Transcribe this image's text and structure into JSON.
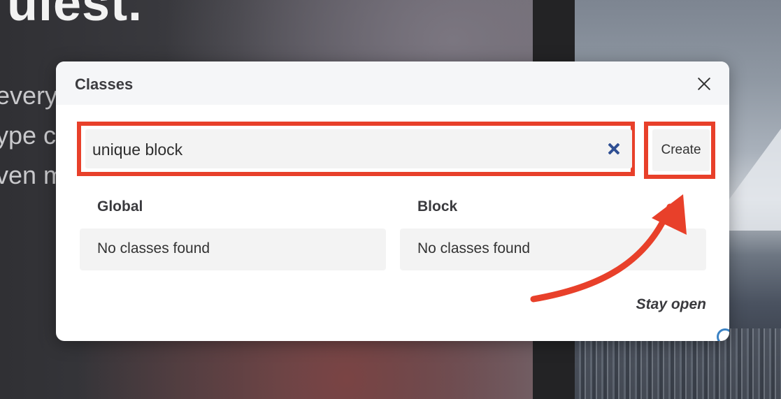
{
  "background": {
    "heading_fragment": "uiest.",
    "text_lines": [
      "every",
      "ype c",
      "ven m"
    ]
  },
  "modal": {
    "title": "Classes",
    "close_icon": "close-icon",
    "search": {
      "value": "unique block",
      "clear_icon": "clear-x-icon"
    },
    "create_label": "Create",
    "columns": {
      "global": {
        "label": "Global",
        "empty_text": "No classes found"
      },
      "block": {
        "label": "Block",
        "empty_text": "No classes found"
      }
    },
    "stay_open_label": "Stay open"
  },
  "annotation": {
    "highlight_color": "#e8402a",
    "arrow_icon": "curved-arrow-icon"
  }
}
